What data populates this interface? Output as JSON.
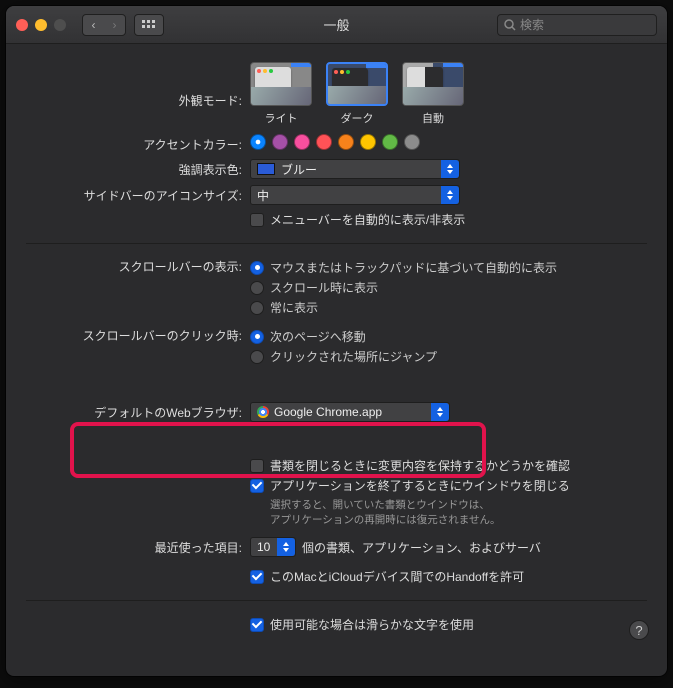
{
  "window": {
    "title": "一般"
  },
  "search": {
    "placeholder": "検索"
  },
  "labels": {
    "appearance": "外観モード:",
    "accent": "アクセントカラー:",
    "highlight": "強調表示色:",
    "sidebar": "サイドバーのアイコンサイズ:",
    "scrollbar_show": "スクロールバーの表示:",
    "scrollbar_click": "スクロールバーのクリック時:",
    "browser": "デフォルトのWebブラウザ:",
    "recent": "最近使った項目:"
  },
  "appearance": {
    "options": [
      {
        "label": "ライト",
        "selected": false
      },
      {
        "label": "ダーク",
        "selected": true
      },
      {
        "label": "自動",
        "selected": false
      }
    ]
  },
  "accent_colors": [
    {
      "hex": "#0a84ff",
      "selected": true
    },
    {
      "hex": "#a550a7",
      "selected": false
    },
    {
      "hex": "#f74f9e",
      "selected": false
    },
    {
      "hex": "#ff5257",
      "selected": false
    },
    {
      "hex": "#f7821b",
      "selected": false
    },
    {
      "hex": "#ffc600",
      "selected": false
    },
    {
      "hex": "#62ba46",
      "selected": false
    },
    {
      "hex": "#8c8c8c",
      "selected": false
    }
  ],
  "highlight": {
    "value": "ブルー"
  },
  "sidebar": {
    "value": "中"
  },
  "menubar_autohide": {
    "label": "メニューバーを自動的に表示/非表示",
    "checked": false
  },
  "scrollbar_show": {
    "options": [
      {
        "label": "マウスまたはトラックパッドに基づいて自動的に表示",
        "checked": true
      },
      {
        "label": "スクロール時に表示",
        "checked": false
      },
      {
        "label": "常に表示",
        "checked": false
      }
    ]
  },
  "scrollbar_click": {
    "options": [
      {
        "label": "次のページへ移動",
        "checked": true
      },
      {
        "label": "クリックされた場所にジャンプ",
        "checked": false
      }
    ]
  },
  "browser": {
    "value": "Google Chrome.app"
  },
  "docs": {
    "ask_save": {
      "label": "書類を閉じるときに変更内容を保持するかどうかを確認",
      "checked": false
    },
    "close_win": {
      "label": "アプリケーションを終了するときにウインドウを閉じる",
      "checked": true
    },
    "note_l1": "選択すると、開いていた書類とウインドウは、",
    "note_l2": "アプリケーションの再開時には復元されません。"
  },
  "recent": {
    "value": "10",
    "suffix": "個の書類、アプリケーション、およびサーバ"
  },
  "handoff": {
    "label": "このMacとiCloudデバイス間でのHandoffを許可",
    "checked": true
  },
  "smooth_font": {
    "label": "使用可能な場合は滑らかな文字を使用",
    "checked": true
  },
  "help": {
    "label": "?"
  }
}
